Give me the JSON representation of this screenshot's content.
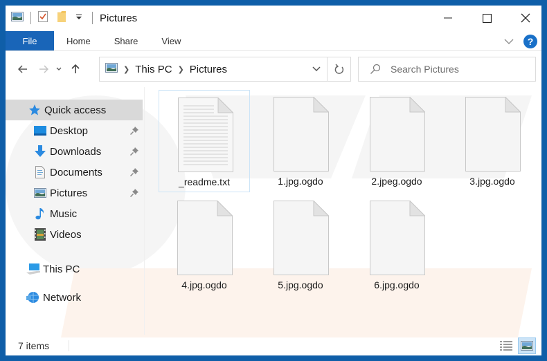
{
  "window": {
    "title": "Pictures",
    "controls": {
      "minimize": "minimize",
      "maximize": "maximize",
      "close": "close"
    }
  },
  "colors": {
    "frame": "#0f5ea8",
    "file_tab": "#1965b8",
    "selection": "#cce4f7",
    "sidebar_selected": "#d9d9d9",
    "help": "#1970c8"
  },
  "ribbon": {
    "tabs": [
      {
        "label": "File",
        "active": true
      },
      {
        "label": "Home"
      },
      {
        "label": "Share"
      },
      {
        "label": "View"
      }
    ],
    "help_label": "?"
  },
  "navigation": {
    "breadcrumbs": [
      "This PC",
      "Pictures"
    ],
    "search_placeholder": "Search Pictures"
  },
  "sidebar": {
    "items": [
      {
        "label": "Quick access",
        "icon": "star-icon",
        "selected": true,
        "pinned": false
      },
      {
        "label": "Desktop",
        "icon": "desktop-icon",
        "pinned": true
      },
      {
        "label": "Downloads",
        "icon": "download-arrow-icon",
        "pinned": true
      },
      {
        "label": "Documents",
        "icon": "document-icon",
        "pinned": true
      },
      {
        "label": "Pictures",
        "icon": "pictures-icon",
        "pinned": true
      },
      {
        "label": "Music",
        "icon": "music-note-icon",
        "pinned": false
      },
      {
        "label": "Videos",
        "icon": "film-icon",
        "pinned": false
      },
      {
        "label": "This PC",
        "icon": "computer-icon",
        "pinned": false
      },
      {
        "label": "Network",
        "icon": "network-icon",
        "pinned": false
      }
    ]
  },
  "files": [
    {
      "name": "_readme.txt",
      "type": "text",
      "selected": true
    },
    {
      "name": "1.jpg.ogdo",
      "type": "blank"
    },
    {
      "name": "2.jpeg.ogdo",
      "type": "blank"
    },
    {
      "name": "3.jpg.ogdo",
      "type": "blank"
    },
    {
      "name": "4.jpg.ogdo",
      "type": "blank"
    },
    {
      "name": "5.jpg.ogdo",
      "type": "blank"
    },
    {
      "name": "6.jpg.ogdo",
      "type": "blank"
    }
  ],
  "status": {
    "item_count": "7 items"
  }
}
